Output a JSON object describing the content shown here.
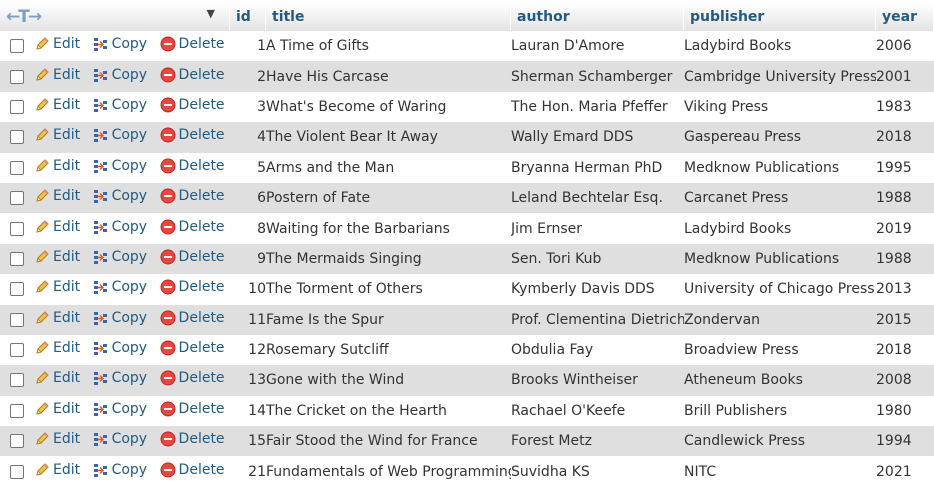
{
  "header": {
    "nav_arrows": "←T→",
    "sort_indicator": "▼",
    "columns": [
      "id",
      "title",
      "author",
      "publisher",
      "year"
    ]
  },
  "actions": {
    "edit": "Edit",
    "copy": "Copy",
    "delete": "Delete"
  },
  "colors": {
    "link": "#235a81",
    "row_alt": "#dfdfdf",
    "delete_icon": "#e8473f",
    "edit_icon": "#e0a82a"
  },
  "icons": {
    "edit": "pencil-icon",
    "copy": "copy-icon",
    "delete": "delete-icon"
  },
  "rows": [
    {
      "id": "1",
      "title": "A Time of Gifts",
      "author": "Lauran D'Amore",
      "publisher": "Ladybird Books",
      "year": "2006"
    },
    {
      "id": "2",
      "title": "Have His Carcase",
      "author": "Sherman Schamberger",
      "publisher": "Cambridge University Press",
      "year": "2001"
    },
    {
      "id": "3",
      "title": "What's Become of Waring",
      "author": "The Hon. Maria Pfeffer",
      "publisher": "Viking Press",
      "year": "1983"
    },
    {
      "id": "4",
      "title": "The Violent Bear It Away",
      "author": "Wally Emard DDS",
      "publisher": "Gaspereau Press",
      "year": "2018"
    },
    {
      "id": "5",
      "title": "Arms and the Man",
      "author": "Bryanna Herman PhD",
      "publisher": "Medknow Publications",
      "year": "1995"
    },
    {
      "id": "6",
      "title": "Postern of Fate",
      "author": "Leland Bechtelar Esq.",
      "publisher": "Carcanet Press",
      "year": "1988"
    },
    {
      "id": "8",
      "title": "Waiting for the Barbarians",
      "author": "Jim Ernser",
      "publisher": "Ladybird Books",
      "year": "2019"
    },
    {
      "id": "9",
      "title": "The Mermaids Singing",
      "author": "Sen. Tori Kub",
      "publisher": "Medknow Publications",
      "year": "1988"
    },
    {
      "id": "10",
      "title": "The Torment of Others",
      "author": "Kymberly Davis DDS",
      "publisher": "University of Chicago Press",
      "year": "2013"
    },
    {
      "id": "11",
      "title": "Fame Is the Spur",
      "author": "Prof. Clementina Dietrich",
      "publisher": "Zondervan",
      "year": "2015"
    },
    {
      "id": "12",
      "title": "Rosemary Sutcliff",
      "author": "Obdulia Fay",
      "publisher": "Broadview Press",
      "year": "2018"
    },
    {
      "id": "13",
      "title": "Gone with the Wind",
      "author": "Brooks Wintheiser",
      "publisher": "Atheneum Books",
      "year": "2008"
    },
    {
      "id": "14",
      "title": "The Cricket on the Hearth",
      "author": "Rachael O'Keefe",
      "publisher": "Brill Publishers",
      "year": "1980"
    },
    {
      "id": "15",
      "title": "Fair Stood the Wind for France",
      "author": "Forest Metz",
      "publisher": "Candlewick Press",
      "year": "1994"
    },
    {
      "id": "21",
      "title": "Fundamentals of Web Programming",
      "author": "Suvidha KS",
      "publisher": "NITC",
      "year": "2021"
    }
  ]
}
